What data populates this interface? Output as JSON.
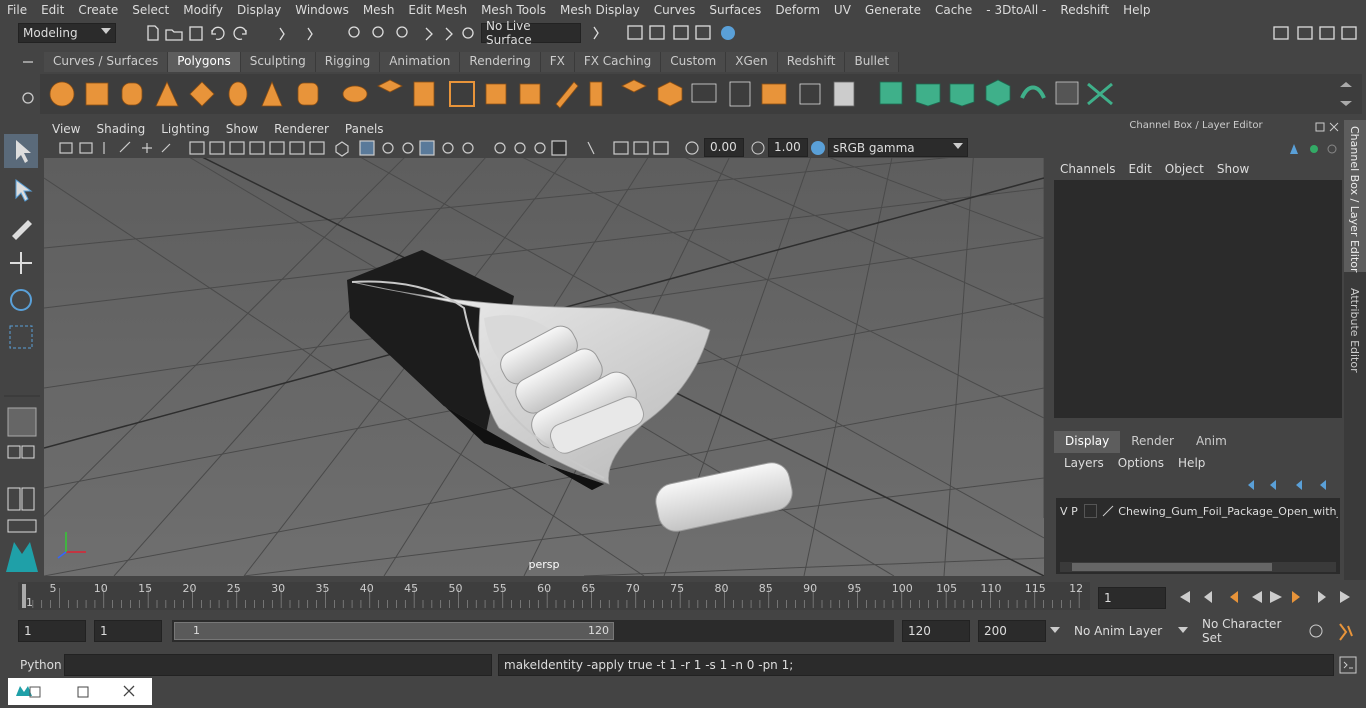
{
  "menubar": {
    "items": [
      "File",
      "Edit",
      "Create",
      "Select",
      "Modify",
      "Display",
      "Windows",
      "Mesh",
      "Edit Mesh",
      "Mesh Tools",
      "Mesh Display",
      "Curves",
      "Surfaces",
      "Deform",
      "UV",
      "Generate",
      "Cache",
      "- 3DtoAll -",
      "Redshift",
      "Help"
    ]
  },
  "statusline": {
    "mode": "Modeling",
    "live_surface": "No Live Surface"
  },
  "shelf": {
    "tabs": [
      "Curves / Surfaces",
      "Polygons",
      "Sculpting",
      "Rigging",
      "Animation",
      "Rendering",
      "FX",
      "FX Caching",
      "Custom",
      "XGen",
      "Redshift",
      "Bullet"
    ],
    "active_tab": "Polygons"
  },
  "viewport": {
    "menus": [
      "View",
      "Shading",
      "Lighting",
      "Show",
      "Renderer",
      "Panels"
    ],
    "exposure": "0.00",
    "gamma": "1.00",
    "color_space": "sRGB gamma",
    "camera_label": "persp"
  },
  "channel_box": {
    "title": "Channel Box / Layer Editor",
    "menus": [
      "Channels",
      "Edit",
      "Object",
      "Show"
    ],
    "layer_tabs": [
      "Display",
      "Render",
      "Anim"
    ],
    "active_layer_tab": "Display",
    "layer_menus": [
      "Layers",
      "Options",
      "Help"
    ],
    "layer": {
      "v": "V",
      "p": "P",
      "name": "Chewing_Gum_Foil_Package_Open_with_Pa"
    }
  },
  "side_tabs": [
    "Channel Box / Layer Editor",
    "Attribute Editor"
  ],
  "timeline": {
    "ticks": [
      "1",
      "5",
      "10",
      "15",
      "20",
      "25",
      "30",
      "35",
      "40",
      "45",
      "50",
      "55",
      "60",
      "65",
      "70",
      "75",
      "80",
      "85",
      "90",
      "95",
      "100",
      "105",
      "110",
      "115",
      "12"
    ],
    "current_frame": "1"
  },
  "range": {
    "start": "1",
    "anim_start": "1",
    "slider_start": "1",
    "slider_end": "120",
    "end": "120",
    "anim_end": "200",
    "anim_layer": "No Anim Layer",
    "character_set": "No Character Set"
  },
  "command": {
    "language": "Python",
    "result": "makeIdentity -apply true -t 1 -r 1 -s 1 -n 0 -pn 1;"
  },
  "colors": {
    "shelf_orange": "#e8943a",
    "shelf_green": "#3fb08a",
    "accent_blue": "#5aa0d8",
    "active_tab": "#5d5d5d"
  }
}
